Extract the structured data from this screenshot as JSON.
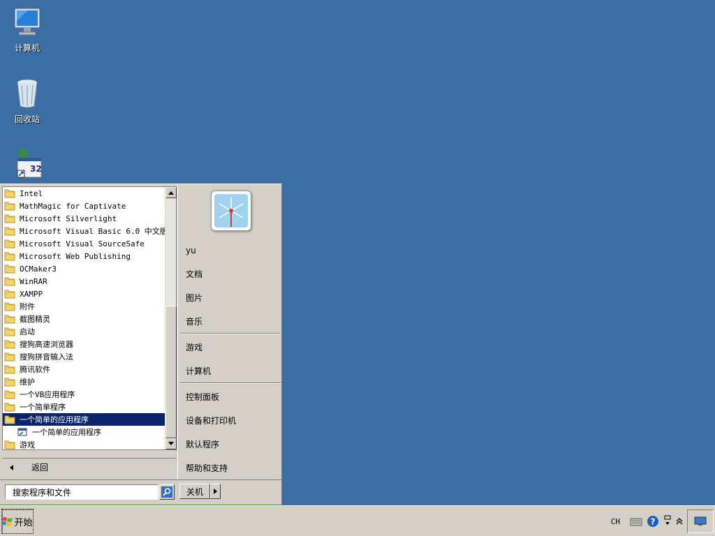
{
  "desktop": {
    "icons": [
      {
        "label": "计算机",
        "icon": "computer-icon"
      },
      {
        "label": "回收站",
        "icon": "recycle-bin-icon"
      },
      {
        "label": "",
        "icon": "vb-shortcut-icon"
      }
    ]
  },
  "start_menu": {
    "programs": [
      {
        "label": "Intel",
        "type": "folder"
      },
      {
        "label": "MathMagic for Captivate",
        "type": "folder"
      },
      {
        "label": "Microsoft Silverlight",
        "type": "folder"
      },
      {
        "label": "Microsoft Visual Basic 6.0 中文版",
        "type": "folder"
      },
      {
        "label": "Microsoft Visual SourceSafe",
        "type": "folder"
      },
      {
        "label": "Microsoft Web Publishing",
        "type": "folder"
      },
      {
        "label": "OCMaker3",
        "type": "folder"
      },
      {
        "label": "WinRAR",
        "type": "folder"
      },
      {
        "label": "XAMPP",
        "type": "folder"
      },
      {
        "label": "附件",
        "type": "folder"
      },
      {
        "label": "截图精灵",
        "type": "folder"
      },
      {
        "label": "启动",
        "type": "folder"
      },
      {
        "label": "搜狗高速浏览器",
        "type": "folder"
      },
      {
        "label": "搜狗拼音输入法",
        "type": "folder"
      },
      {
        "label": "腾讯软件",
        "type": "folder"
      },
      {
        "label": "维护",
        "type": "folder"
      },
      {
        "label": "一个VB应用程序",
        "type": "folder"
      },
      {
        "label": "一个简单程序",
        "type": "folder"
      },
      {
        "label": "一个简单的应用程序",
        "type": "folder",
        "selected": true
      },
      {
        "label": "一个简单的应用程序",
        "type": "app",
        "sub": true
      },
      {
        "label": "游戏",
        "type": "folder"
      }
    ],
    "back_label": "返回",
    "user": {
      "name": "yu"
    },
    "right_items": {
      "documents": "文档",
      "pictures": "图片",
      "music": "音乐",
      "games": "游戏",
      "computer": "计算机",
      "control_panel": "控制面板",
      "devices_printers": "设备和打印机",
      "default_programs": "默认程序",
      "help_support": "帮助和支持"
    },
    "search_placeholder": "搜索程序和文件",
    "shutdown_label": "关机"
  },
  "taskbar": {
    "start_label": "开始",
    "tray_language": "CH"
  },
  "colors": {
    "desktop": "#3a6ea5",
    "selection": "#0a246a",
    "classic_gray": "#d4d0c8"
  }
}
